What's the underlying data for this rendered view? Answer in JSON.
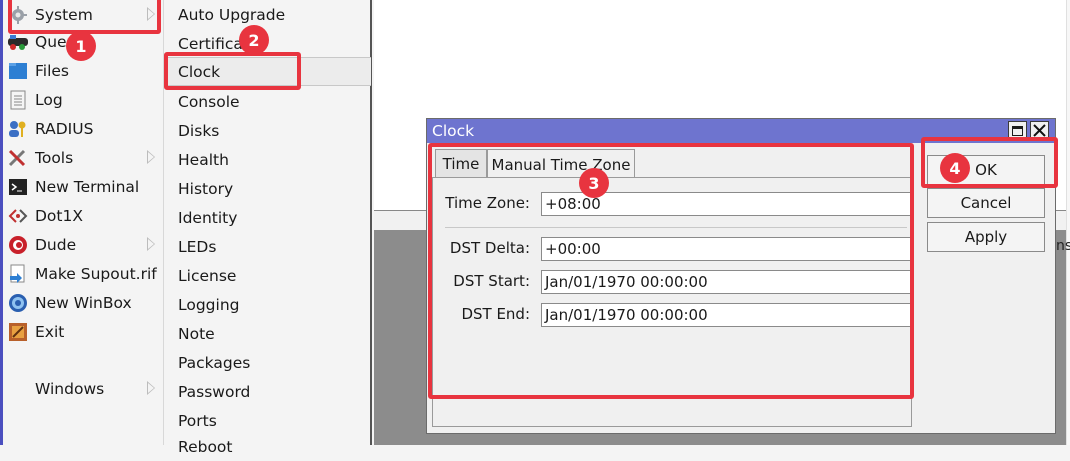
{
  "main_menu": {
    "items": [
      {
        "label": "System",
        "icon": "gear-icon",
        "has_submenu": true
      },
      {
        "label": "Queues",
        "icon": "queue-icon",
        "has_submenu": false
      },
      {
        "label": "Files",
        "icon": "folder-icon",
        "has_submenu": false
      },
      {
        "label": "Log",
        "icon": "log-icon",
        "has_submenu": false
      },
      {
        "label": "RADIUS",
        "icon": "users-icon",
        "has_submenu": false
      },
      {
        "label": "Tools",
        "icon": "tools-icon",
        "has_submenu": true
      },
      {
        "label": "New Terminal",
        "icon": "terminal-icon",
        "has_submenu": false
      },
      {
        "label": "Dot1X",
        "icon": "dot1x-icon",
        "has_submenu": false
      },
      {
        "label": "Dude",
        "icon": "dude-icon",
        "has_submenu": true
      },
      {
        "label": "Make Supout.rif",
        "icon": "supout-icon",
        "has_submenu": false
      },
      {
        "label": "New WinBox",
        "icon": "winbox-icon",
        "has_submenu": false
      },
      {
        "label": "Exit",
        "icon": "exit-icon",
        "has_submenu": false
      },
      {
        "label": "Windows",
        "icon": "",
        "has_submenu": true
      }
    ]
  },
  "submenu": {
    "items": [
      "Auto Upgrade",
      "Certificates",
      "Clock",
      "Console",
      "Disks",
      "Health",
      "History",
      "Identity",
      "LEDs",
      "License",
      "Logging",
      "Note",
      "Packages",
      "Password",
      "Ports",
      "Reboot"
    ]
  },
  "clock_window": {
    "title": "Clock",
    "tabs": [
      "Time",
      "Manual Time Zone"
    ],
    "fields": {
      "time_zone": {
        "label": "Time Zone:",
        "value": "+08:00"
      },
      "dst_delta": {
        "label": "DST Delta:",
        "value": "+00:00"
      },
      "dst_start": {
        "label": "DST Start:",
        "value": "Jan/01/1970 00:00:00"
      },
      "dst_end": {
        "label": "DST End:",
        "value": "Jan/01/1970 00:00:00"
      }
    },
    "buttons": {
      "ok": "OK",
      "cancel": "Cancel",
      "apply": "Apply"
    }
  },
  "badges": [
    "1",
    "2",
    "3",
    "4"
  ],
  "partial_text": "ns",
  "colors": {
    "highlight": "#e8343f",
    "titlebar": "#6e74cf",
    "sidebar_strip": "#4b4fbf"
  }
}
